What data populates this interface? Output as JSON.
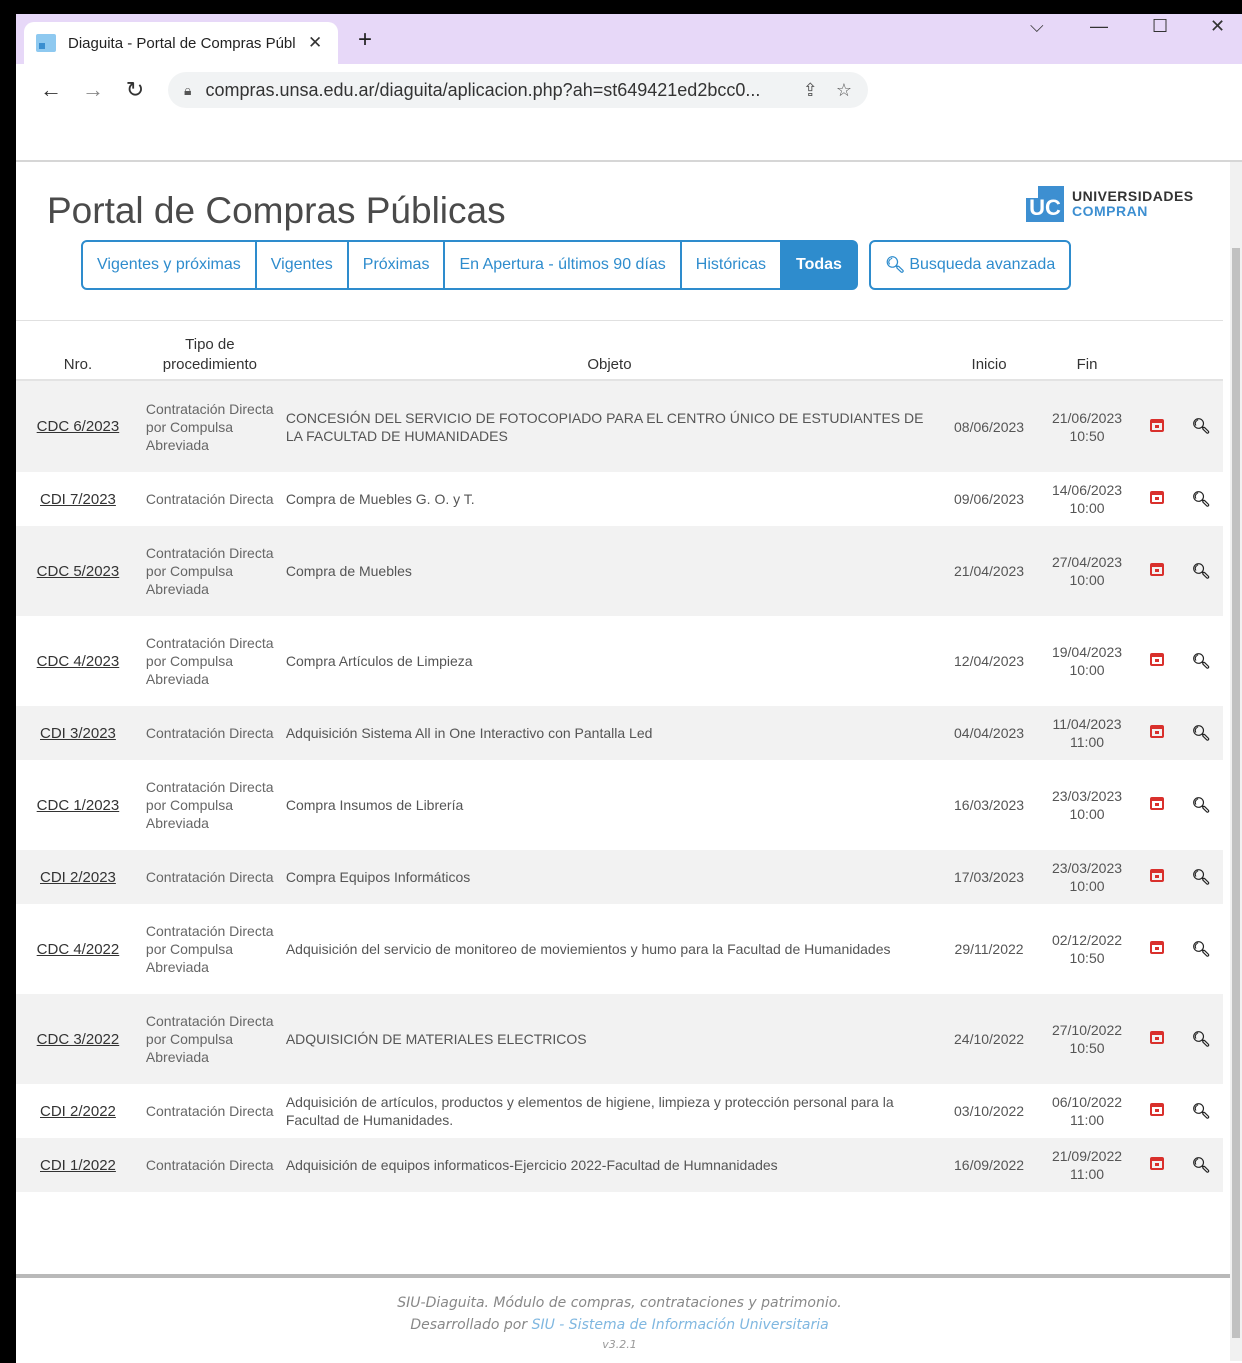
{
  "browser": {
    "tab_title": "Diaguita - Portal de Compras Públ",
    "new_tab": "+",
    "url": "compras.unsa.edu.ar/diaguita/aplicacion.php?ah=st649421ed2bcc0..."
  },
  "page": {
    "title": "Portal de Compras Públicas",
    "logo": {
      "mark": "UC",
      "line1": "UNIVERSIDADES",
      "line2": "COMPRAN"
    },
    "filters": [
      "Vigentes y próximas",
      "Vigentes",
      "Próximas",
      "En Apertura - últimos 90 días",
      "Históricas",
      "Todas"
    ],
    "active_filter": "Todas",
    "advanced_search": "Busqueda avanzada"
  },
  "table": {
    "headers": {
      "nro": "Nro.",
      "tipo": "Tipo de procedimiento",
      "objeto": "Objeto",
      "inicio": "Inicio",
      "fin": "Fin"
    },
    "rows": [
      {
        "nro": "CDC 6/2023",
        "tipo": "Contratación Directa por Compulsa Abreviada",
        "objeto": "CONCESIÓN DEL SERVICIO DE FOTOCOPIADO PARA EL CENTRO ÚNICO DE ESTUDIANTES DE LA FACULTAD DE HUMANIDADES",
        "inicio": "08/06/2023",
        "fin_fecha": "21/06/2023",
        "fin_hora": "10:50"
      },
      {
        "nro": "CDI 7/2023",
        "tipo": "Contratación Directa",
        "objeto": "Compra de Muebles G. O. y T.",
        "inicio": "09/06/2023",
        "fin_fecha": "14/06/2023",
        "fin_hora": "10:00"
      },
      {
        "nro": "CDC 5/2023",
        "tipo": "Contratación Directa por Compulsa Abreviada",
        "objeto": "Compra de Muebles",
        "inicio": "21/04/2023",
        "fin_fecha": "27/04/2023",
        "fin_hora": "10:00"
      },
      {
        "nro": "CDC 4/2023",
        "tipo": "Contratación Directa por Compulsa Abreviada",
        "objeto": "Compra Artículos de Limpieza",
        "inicio": "12/04/2023",
        "fin_fecha": "19/04/2023",
        "fin_hora": "10:00"
      },
      {
        "nro": "CDI 3/2023",
        "tipo": "Contratación Directa",
        "objeto": "Adquisición Sistema All in One Interactivo con Pantalla Led",
        "inicio": "04/04/2023",
        "fin_fecha": "11/04/2023",
        "fin_hora": "11:00"
      },
      {
        "nro": "CDC 1/2023",
        "tipo": "Contratación Directa por Compulsa Abreviada",
        "objeto": "Compra Insumos de Librería",
        "inicio": "16/03/2023",
        "fin_fecha": "23/03/2023",
        "fin_hora": "10:00"
      },
      {
        "nro": "CDI 2/2023",
        "tipo": "Contratación Directa",
        "objeto": "Compra Equipos Informáticos",
        "inicio": "17/03/2023",
        "fin_fecha": "23/03/2023",
        "fin_hora": "10:00"
      },
      {
        "nro": "CDC 4/2022",
        "tipo": "Contratación Directa por Compulsa Abreviada",
        "objeto": "Adquisición del servicio de monitoreo de moviemientos y humo para la Facultad de Humanidades",
        "inicio": "29/11/2022",
        "fin_fecha": "02/12/2022",
        "fin_hora": "10:50"
      },
      {
        "nro": "CDC 3/2022",
        "tipo": "Contratación Directa por Compulsa Abreviada",
        "objeto": "ADQUISICIÓN DE MATERIALES ELECTRICOS",
        "inicio": "24/10/2022",
        "fin_fecha": "27/10/2022",
        "fin_hora": "10:50"
      },
      {
        "nro": "CDI 2/2022",
        "tipo": "Contratación Directa",
        "objeto": "Adquisición de artículos, productos y elementos de higiene, limpieza y protección personal para la Facultad de Humanidades.",
        "inicio": "03/10/2022",
        "fin_fecha": "06/10/2022",
        "fin_hora": "11:00"
      },
      {
        "nro": "CDI 1/2022",
        "tipo": "Contratación Directa",
        "objeto": "Adquisición de equipos informaticos-Ejercicio 2022-Facultad de Humnanidades",
        "inicio": "16/09/2022",
        "fin_fecha": "21/09/2022",
        "fin_hora": "11:00"
      }
    ]
  },
  "footer": {
    "line1": "SIU-Diaguita. Módulo de compras, contrataciones y patrimonio.",
    "line2_prefix": "Desarrollado por",
    "line2_link": "SIU - Sistema de Información Universitaria",
    "version": "v3.2.1"
  },
  "colors": {
    "accent": "#2e8ccd",
    "tab_strip": "#e7d8f8",
    "calendar_icon": "#d9302c"
  }
}
